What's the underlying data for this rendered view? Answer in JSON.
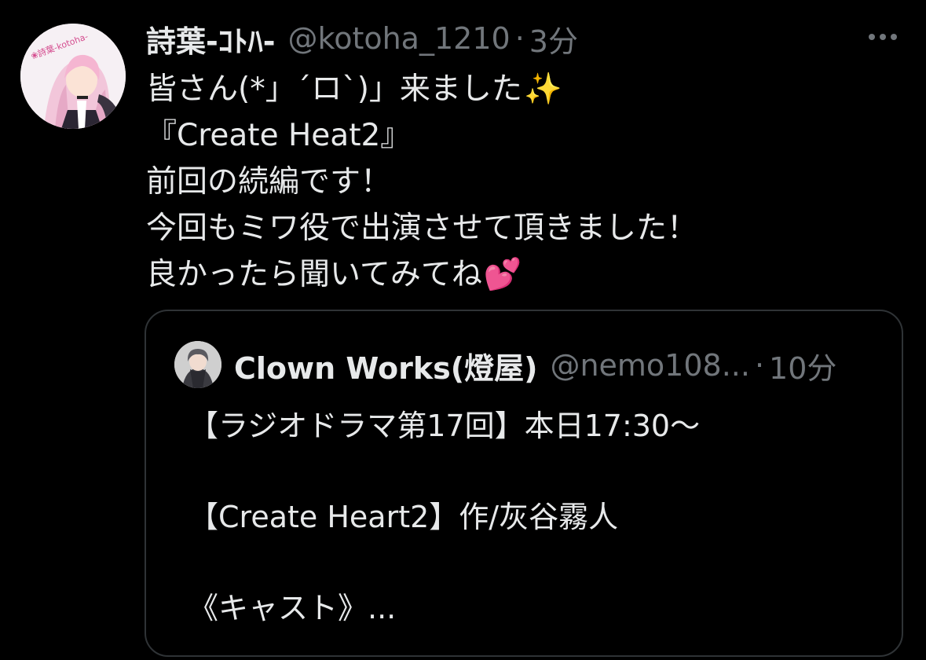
{
  "tweet": {
    "author_name": "詩葉-ｺﾄﾊ-",
    "author_handle": "@kotoha_1210",
    "separator": "·",
    "time": "3分",
    "body_lines": [
      "皆さん(*」´ロ`)」来ました",
      "『Create Heat2』",
      "前回の続編です！",
      "今回もミワ役で出演させて頂きました！",
      "良かったら聞いてみてね"
    ],
    "emoji": {
      "sparkles": "✨",
      "two_hearts": "💕"
    },
    "avatar_icon": "profile-avatar-icon",
    "more_icon": "more-horizontal-icon"
  },
  "quote": {
    "author_name": "Clown Works(燈屋)",
    "author_handle": "@nemo108...",
    "separator": "·",
    "time": "10分",
    "lines": [
      "【ラジオドラマ第17回】本日17:30〜",
      "【Create Heart2】作/灰谷霧人",
      "《キャスト》..."
    ],
    "avatar_icon": "quote-avatar-icon"
  },
  "colors": {
    "background": "#000000",
    "primary_text": "#e7e9ea",
    "secondary_text": "#71767b",
    "border": "#2f3336"
  }
}
